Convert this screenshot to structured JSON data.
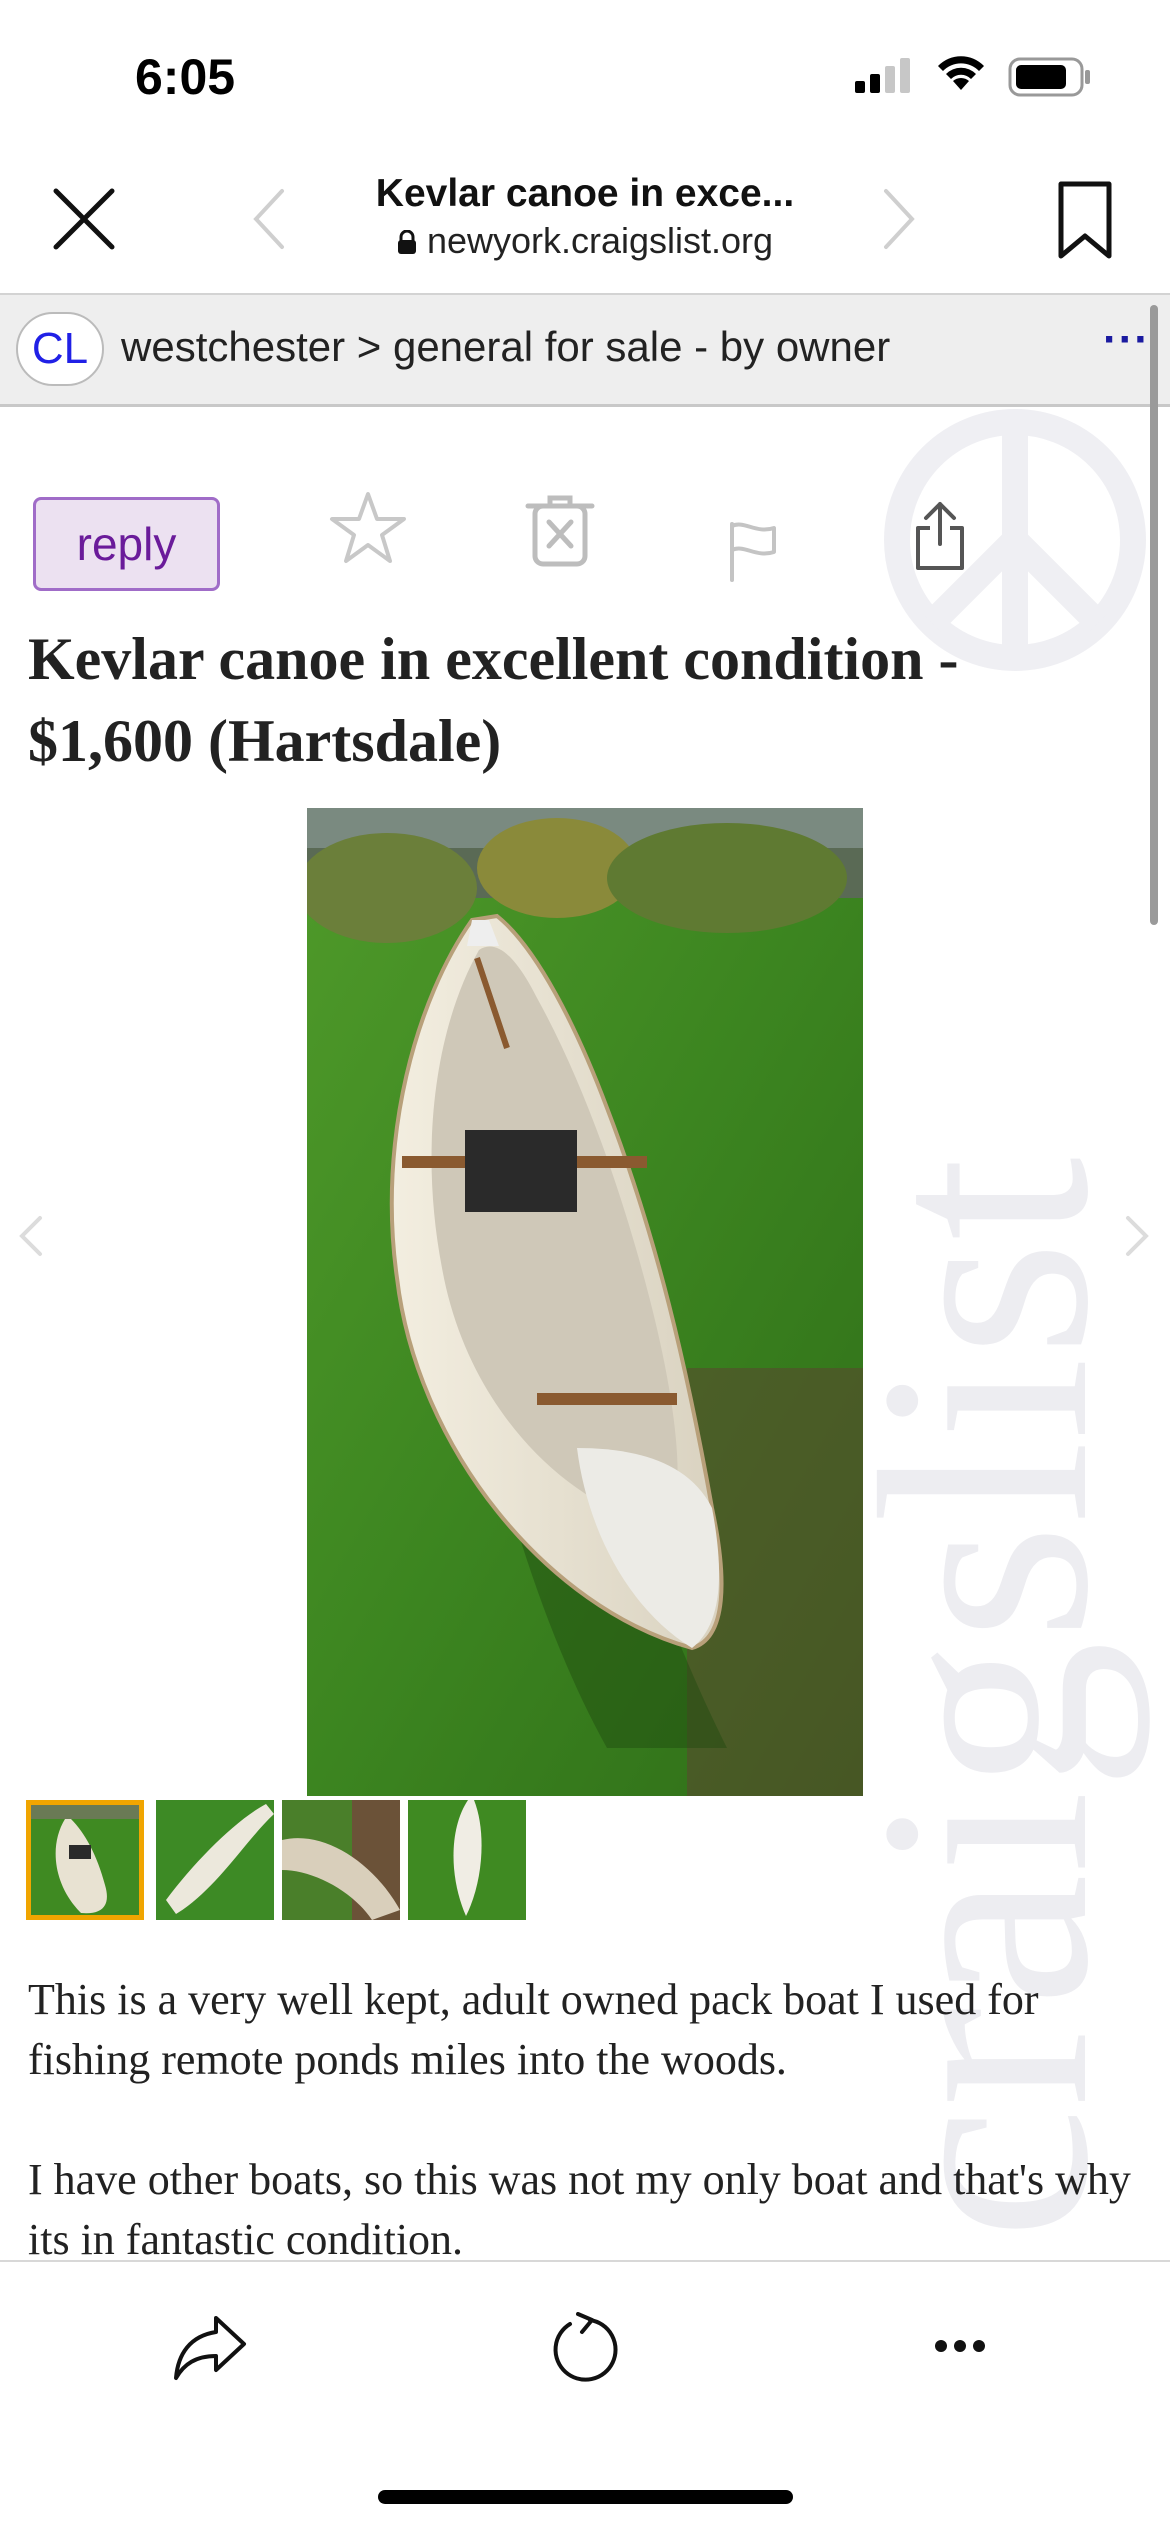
{
  "status_bar": {
    "time": "6:05"
  },
  "browser": {
    "page_title": "Kevlar canoe in exce...",
    "url": "newyork.craigslist.org"
  },
  "breadcrumb": {
    "logo": "CL",
    "path": "westchester > general for sale - by owner",
    "more": "···"
  },
  "actions": {
    "reply_label": "reply"
  },
  "listing": {
    "title": "Kevlar canoe in excellent condition - $1,600 (Hartsdale)",
    "photo_count": 4,
    "selected_photo": 1,
    "description": [
      "This is a very well kept, adult owned pack boat I used for fishing remote ponds miles into the woods.",
      "I have other boats, so this was not my only boat and that's why its in fantastic condition."
    ]
  },
  "watermark": "craigslist",
  "colors": {
    "reply_bg": "#ece1f1",
    "reply_border": "#a06cc8",
    "reply_text": "#6a1b9a",
    "logo_text": "#2020e6",
    "thumb_selected": "#f0a500",
    "grass": "#3f8a22"
  }
}
